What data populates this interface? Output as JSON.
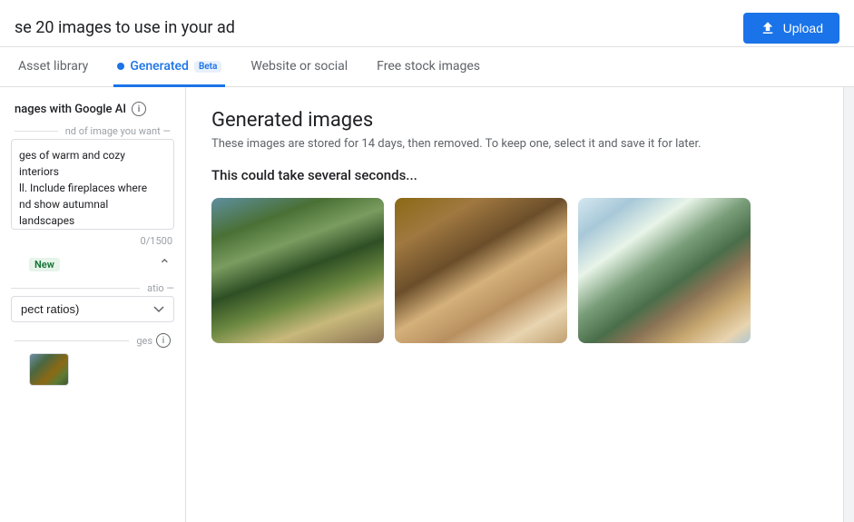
{
  "header": {
    "title": "se 20 images to use in your ad",
    "upload_label": "Upload",
    "upload_icon": "upload"
  },
  "tabs": [
    {
      "id": "asset-library",
      "label": "Asset library",
      "active": false,
      "beta": false,
      "dot": false
    },
    {
      "id": "generated",
      "label": "Generated",
      "active": true,
      "beta": true,
      "dot": true
    },
    {
      "id": "website-or-social",
      "label": "Website or social",
      "active": false,
      "beta": false,
      "dot": false
    },
    {
      "id": "free-stock-images",
      "label": "Free stock images",
      "active": false,
      "beta": false,
      "dot": false
    }
  ],
  "sidebar": {
    "section_title": "nages with Google AI",
    "info_icon": "ⓘ",
    "prompt_label": "nd of image you want —",
    "prompt_value": "ges of warm and cozy interiors\nll. Include fireplaces where\nnd show autumnal landscapes\nlows",
    "char_count": "0/1500",
    "new_badge": "New",
    "aspect_ratio_label": "atio —",
    "aspect_ratio_placeholder": "pect ratios)",
    "images_label": "ges",
    "collapse_icon": "^"
  },
  "main": {
    "title": "Generated images",
    "subtitle": "These images are stored for 14 days, then removed. To keep one, select it and save it for later.",
    "loading_text": "This could take several seconds...",
    "images": [
      {
        "id": "img1",
        "alt": "Cozy interior with large windows and mountain view",
        "style": "img1"
      },
      {
        "id": "img2",
        "alt": "Warm wood interior with vaulted ceiling",
        "style": "img2"
      },
      {
        "id": "img3",
        "alt": "Open deck with glass doors and autumn view",
        "style": "img3"
      }
    ]
  }
}
